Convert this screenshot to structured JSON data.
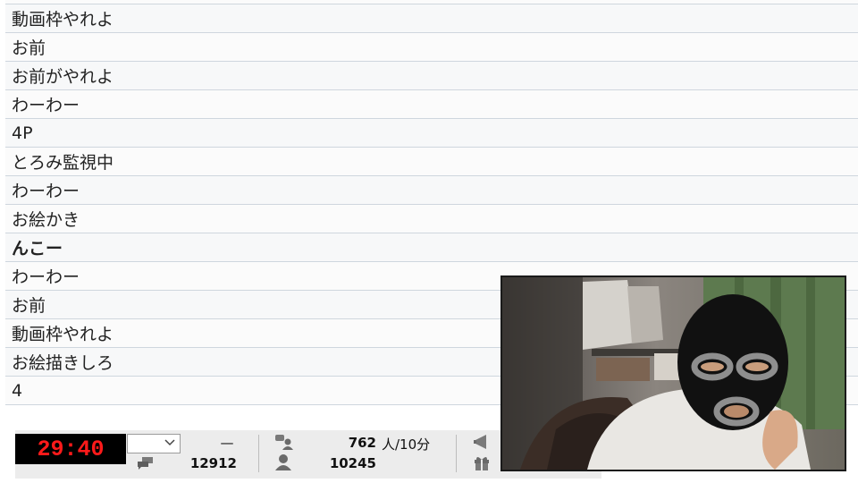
{
  "comments": [
    {
      "text": "わーわー",
      "bold": false
    },
    {
      "text": "動画枠やれよ",
      "bold": false
    },
    {
      "text": "お前",
      "bold": false
    },
    {
      "text": "お前がやれよ",
      "bold": false
    },
    {
      "text": "わーわー",
      "bold": false
    },
    {
      "text": "4P",
      "bold": false
    },
    {
      "text": "とろみ監視中",
      "bold": false
    },
    {
      "text": "わーわー",
      "bold": false
    },
    {
      "text": "お絵かき",
      "bold": false
    },
    {
      "text": "んこー",
      "bold": true
    },
    {
      "text": "わーわー",
      "bold": false
    },
    {
      "text": "お前",
      "bold": false
    },
    {
      "text": "動画枠やれよ",
      "bold": false
    },
    {
      "text": "お絵描きしろ",
      "bold": false
    },
    {
      "text": "4",
      "bold": false
    }
  ],
  "status_bar": {
    "timer": "29:40",
    "dash": "—",
    "comment_count": "12912",
    "active_viewers": "762",
    "active_unit": "人/10分",
    "total_viewers": "10245"
  },
  "icons": {
    "timer_select_chevron": "chevron-down-icon",
    "comments": "comment-bubble-icon",
    "active_users": "active-users-icon",
    "viewers": "person-icon",
    "ad": "megaphone-icon",
    "gift": "gift-icon"
  },
  "colors": {
    "timer_bg": "#000000",
    "timer_text": "#ff1a1a",
    "row_border": "#cfd6de",
    "status_bg": "#ececec"
  }
}
